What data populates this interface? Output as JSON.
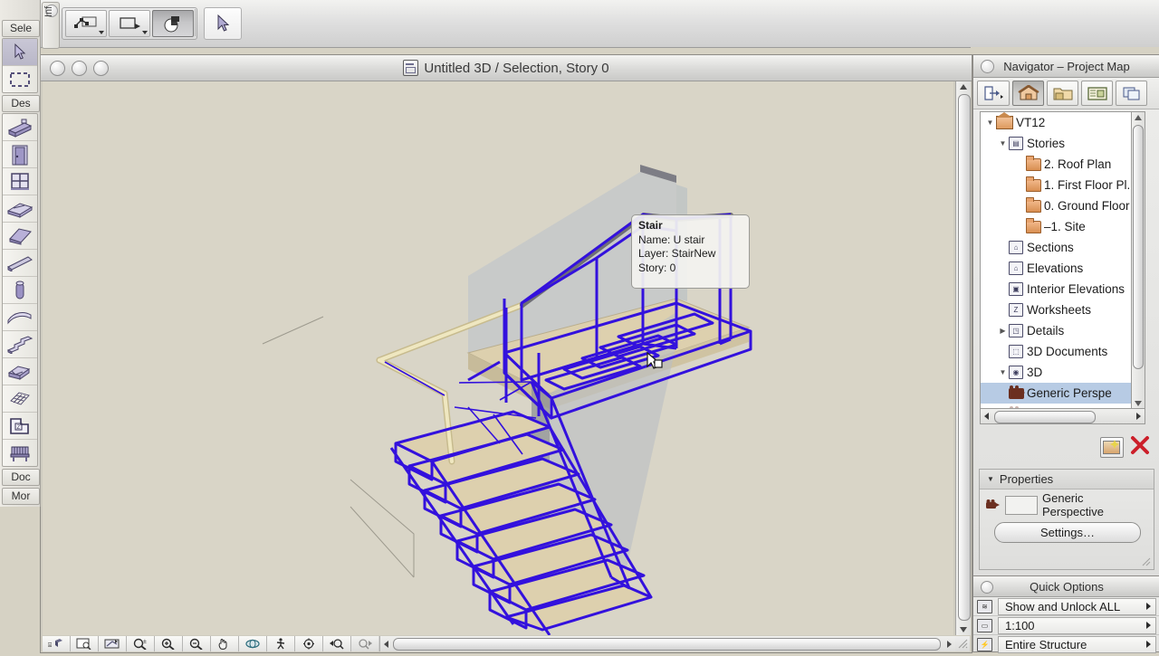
{
  "app": {
    "window_title": "Untitled 3D / Selection, Story 0",
    "background_color": "#d9d5c7"
  },
  "toolbar": {
    "buttons": [
      {
        "name": "measure-tool",
        "label": "",
        "icon": "measure-icon",
        "pressed": false,
        "has_caret": true
      },
      {
        "name": "marquee-tool",
        "label": "",
        "icon": "rectangle-marquee-icon",
        "pressed": false,
        "has_caret": true
      },
      {
        "name": "solid-element-operations",
        "label": "",
        "icon": "solid-operations-icon",
        "pressed": true,
        "has_caret": false
      }
    ],
    "arrow_button": {
      "name": "arrow-tool",
      "icon": "arrow-cursor-icon"
    }
  },
  "toolbox": {
    "sections": [
      {
        "label": "Sele",
        "tools": [
          {
            "name": "arrow-tool",
            "icon": "arrow-cursor-icon",
            "selected": true
          },
          {
            "name": "marquee-tool",
            "icon": "marquee-icon",
            "selected": false
          }
        ]
      },
      {
        "label": "Des",
        "tools": [
          {
            "name": "wall-tool",
            "icon": "wall-icon",
            "selected": false
          },
          {
            "name": "door-tool",
            "icon": "door-icon",
            "selected": false
          },
          {
            "name": "window-tool",
            "icon": "window-icon",
            "selected": false
          },
          {
            "name": "slab-tool",
            "icon": "slab-icon",
            "selected": false
          },
          {
            "name": "roof-tool",
            "icon": "roof-icon",
            "selected": false
          },
          {
            "name": "beam-tool",
            "icon": "beam-icon",
            "selected": false
          },
          {
            "name": "column-tool",
            "icon": "column-icon",
            "selected": false
          },
          {
            "name": "shell-tool",
            "icon": "shell-icon",
            "selected": false
          },
          {
            "name": "stair-tool",
            "icon": "stair-icon",
            "selected": false
          },
          {
            "name": "morph-tool",
            "icon": "morph-icon",
            "selected": false
          },
          {
            "name": "mesh-tool",
            "icon": "mesh-icon",
            "selected": false
          },
          {
            "name": "zone-tool",
            "icon": "zone-icon",
            "selected": false
          },
          {
            "name": "object-tool",
            "icon": "furniture-icon",
            "selected": false
          }
        ]
      }
    ],
    "footer_labels": [
      "Doc",
      "Mor"
    ],
    "side_tab_label": "Inf"
  },
  "tooltip": {
    "title": "Stair",
    "lines": [
      "Name: U stair",
      "Layer: StairNew",
      "Story: 0"
    ]
  },
  "navigator": {
    "title": "Navigator – Project Map",
    "toolbar_buttons": [
      {
        "name": "export-navigator-button",
        "icon": "export-icon",
        "pressed": false
      },
      {
        "name": "project-map-button",
        "icon": "project-map-house-icon",
        "pressed": true
      },
      {
        "name": "view-map-button",
        "icon": "view-map-folder-icon",
        "pressed": false
      },
      {
        "name": "layout-book-button",
        "icon": "layout-book-icon",
        "pressed": false
      },
      {
        "name": "publisher-sets-button",
        "icon": "publisher-sets-icon",
        "pressed": false
      }
    ],
    "tree": [
      {
        "label": "VT12",
        "indent": 0,
        "twisty": "down",
        "icon": "project-house-icon",
        "selected": false
      },
      {
        "label": "Stories",
        "indent": 1,
        "twisty": "down",
        "icon": "stories-icon",
        "selected": false
      },
      {
        "label": "2. Roof Plan",
        "indent": 2,
        "twisty": "none",
        "icon": "folder-icon",
        "selected": false
      },
      {
        "label": "1. First Floor Pl.",
        "indent": 2,
        "twisty": "none",
        "icon": "folder-icon",
        "selected": false
      },
      {
        "label": "0. Ground Floor",
        "indent": 2,
        "twisty": "none",
        "icon": "folder-icon",
        "selected": false
      },
      {
        "label": "–1. Site",
        "indent": 2,
        "twisty": "none",
        "icon": "folder-icon",
        "selected": false
      },
      {
        "label": "Sections",
        "indent": 1,
        "twisty": "none",
        "icon": "section-icon",
        "selected": false
      },
      {
        "label": "Elevations",
        "indent": 1,
        "twisty": "none",
        "icon": "elevation-icon",
        "selected": false
      },
      {
        "label": "Interior Elevations",
        "indent": 1,
        "twisty": "none",
        "icon": "interior-elevation-icon",
        "selected": false
      },
      {
        "label": "Worksheets",
        "indent": 1,
        "twisty": "none",
        "icon": "worksheet-icon",
        "selected": false
      },
      {
        "label": "Details",
        "indent": 1,
        "twisty": "right",
        "icon": "detail-icon",
        "selected": false
      },
      {
        "label": "3D Documents",
        "indent": 1,
        "twisty": "none",
        "icon": "3d-document-icon",
        "selected": false
      },
      {
        "label": "3D",
        "indent": 1,
        "twisty": "down",
        "icon": "3d-icon",
        "selected": false
      },
      {
        "label": "Generic Perspe",
        "indent": 2,
        "twisty": "none",
        "icon": "camera-icon",
        "selected": true
      }
    ],
    "actions": [
      {
        "name": "new-view-button",
        "icon": "new-view-icon"
      },
      {
        "name": "delete-view-button",
        "icon": "red-x-icon"
      }
    ],
    "properties": {
      "header": "Properties",
      "icon": "camera-icon",
      "value": "Generic Perspective",
      "settings_label": "Settings…"
    }
  },
  "quick_options": {
    "title": "Quick Options",
    "rows": [
      {
        "name": "layer-combination-row",
        "icon": "layers-icon",
        "value": "Show and Unlock ALL"
      },
      {
        "name": "scale-row",
        "icon": "scale-icon",
        "value": "1:100"
      },
      {
        "name": "structure-display-row",
        "icon": "structure-icon",
        "value": "Entire Structure"
      }
    ]
  },
  "view_toolbar": [
    {
      "name": "3d-cutaway-button",
      "icon": "cutaway-icon"
    },
    {
      "name": "fit-in-window-button",
      "icon": "fit-window-icon"
    },
    {
      "name": "orient-view-button",
      "icon": "orient-icon"
    },
    {
      "name": "zoom-button",
      "icon": "zoom-icon"
    },
    {
      "name": "zoom-in-button",
      "icon": "zoom-in-icon"
    },
    {
      "name": "zoom-out-button",
      "icon": "zoom-out-icon"
    },
    {
      "name": "pan-button",
      "icon": "hand-icon"
    },
    {
      "name": "orbit-button",
      "icon": "orbit-icon"
    },
    {
      "name": "walk-button",
      "icon": "walk-icon"
    },
    {
      "name": "explore-model-button",
      "icon": "explore-icon"
    },
    {
      "name": "previous-zoom-button",
      "icon": "previous-zoom-icon"
    },
    {
      "name": "next-zoom-button",
      "icon": "next-zoom-icon"
    }
  ],
  "model": {
    "description": "U-shaped stair, selected (blue wireframe) with glass balustrade",
    "selection_color": "#3311dd",
    "tread_color": "#e0d2ae",
    "glass_color": "#c3c8cb",
    "handrail_color": "#ece2b8"
  }
}
